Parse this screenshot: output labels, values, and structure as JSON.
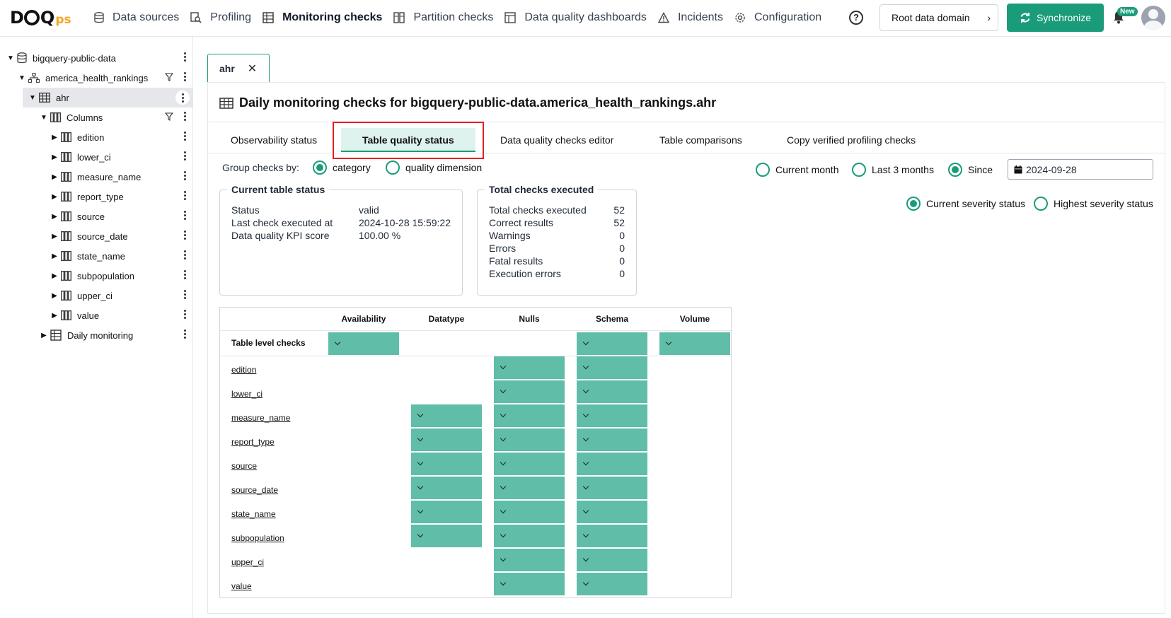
{
  "logo": {
    "main": "DQ",
    "suffix": "ps"
  },
  "nav": [
    {
      "label": "Data sources",
      "icon": "database-icon",
      "active": false
    },
    {
      "label": "Profiling",
      "icon": "profiling-icon",
      "active": false
    },
    {
      "label": "Monitoring checks",
      "icon": "table-check-icon",
      "active": true
    },
    {
      "label": "Partition checks",
      "icon": "partition-icon",
      "active": false
    },
    {
      "label": "Data quality dashboards",
      "icon": "dashboard-icon",
      "active": false
    },
    {
      "label": "Incidents",
      "icon": "warning-icon",
      "active": false
    },
    {
      "label": "Configuration",
      "icon": "gear-icon",
      "active": false
    }
  ],
  "header": {
    "help": "?",
    "domain": "Root data domain",
    "sync": "Synchronize",
    "new_badge": "New"
  },
  "tree": [
    {
      "label": "bigquery-public-data",
      "depth": 0,
      "caret": "▼",
      "icon": "database-icon",
      "filter": false
    },
    {
      "label": "america_health_rankings",
      "depth": 1,
      "caret": "▼",
      "icon": "schema-icon",
      "filter": true
    },
    {
      "label": "ahr",
      "depth": 2,
      "caret": "▼",
      "icon": "table-icon",
      "filter": false,
      "selected": true
    },
    {
      "label": "Columns",
      "depth": 3,
      "caret": "▼",
      "icon": "columns-icon",
      "filter": true
    },
    {
      "label": "edition",
      "depth": 4,
      "caret": "▶",
      "icon": "columns-icon",
      "filter": false
    },
    {
      "label": "lower_ci",
      "depth": 4,
      "caret": "▶",
      "icon": "columns-icon",
      "filter": false
    },
    {
      "label": "measure_name",
      "depth": 4,
      "caret": "▶",
      "icon": "columns-icon",
      "filter": false
    },
    {
      "label": "report_type",
      "depth": 4,
      "caret": "▶",
      "icon": "columns-icon",
      "filter": false
    },
    {
      "label": "source",
      "depth": 4,
      "caret": "▶",
      "icon": "columns-icon",
      "filter": false
    },
    {
      "label": "source_date",
      "depth": 4,
      "caret": "▶",
      "icon": "columns-icon",
      "filter": false
    },
    {
      "label": "state_name",
      "depth": 4,
      "caret": "▶",
      "icon": "columns-icon",
      "filter": false
    },
    {
      "label": "subpopulation",
      "depth": 4,
      "caret": "▶",
      "icon": "columns-icon",
      "filter": false
    },
    {
      "label": "upper_ci",
      "depth": 4,
      "caret": "▶",
      "icon": "columns-icon",
      "filter": false
    },
    {
      "label": "value",
      "depth": 4,
      "caret": "▶",
      "icon": "columns-icon",
      "filter": false
    },
    {
      "label": "Daily monitoring",
      "depth": 3,
      "caret": "▶",
      "icon": "table-check-icon",
      "filter": false
    }
  ],
  "tab": {
    "label": "ahr",
    "close": "✕"
  },
  "title": "Daily monitoring checks for bigquery-public-data.america_health_rankings.ahr",
  "subtabs": [
    "Observability status",
    "Table quality status",
    "Data quality checks editor",
    "Table comparisons",
    "Copy verified profiling checks"
  ],
  "group_by": {
    "label": "Group checks by:",
    "options": [
      "category",
      "quality dimension"
    ],
    "selected": 0
  },
  "period": {
    "options": [
      "Current month",
      "Last 3 months",
      "Since"
    ],
    "selected": 2,
    "since_date": "2024-09-28"
  },
  "severity": {
    "options": [
      "Current severity status",
      "Highest severity status"
    ],
    "selected": 0
  },
  "status_box": {
    "title": "Current table status",
    "rows": [
      {
        "k": "Status",
        "v": "valid"
      },
      {
        "k": "Last check executed at",
        "v": "2024-10-28 15:59:22"
      },
      {
        "k": "Data quality KPI score",
        "v": "100.00 %"
      }
    ]
  },
  "totals_box": {
    "title": "Total checks executed",
    "rows": [
      {
        "k": "Total checks executed",
        "v": "52"
      },
      {
        "k": "Correct results",
        "v": "52"
      },
      {
        "k": "Warnings",
        "v": "0"
      },
      {
        "k": "Errors",
        "v": "0"
      },
      {
        "k": "Fatal results",
        "v": "0"
      },
      {
        "k": "Execution errors",
        "v": "0"
      }
    ]
  },
  "grid": {
    "columns": [
      "Availability",
      "Datatype",
      "Nulls",
      "Schema",
      "Volume"
    ],
    "rows": [
      {
        "label": "Table level checks",
        "bold": true,
        "cells": [
          true,
          false,
          false,
          true,
          true
        ]
      },
      {
        "label": "edition",
        "cells": [
          false,
          false,
          true,
          true,
          false
        ]
      },
      {
        "label": "lower_ci",
        "cells": [
          false,
          false,
          true,
          true,
          false
        ]
      },
      {
        "label": "measure_name",
        "cells": [
          false,
          true,
          true,
          true,
          false
        ]
      },
      {
        "label": "report_type",
        "cells": [
          false,
          true,
          true,
          true,
          false
        ]
      },
      {
        "label": "source",
        "cells": [
          false,
          true,
          true,
          true,
          false
        ]
      },
      {
        "label": "source_date",
        "cells": [
          false,
          true,
          true,
          true,
          false
        ]
      },
      {
        "label": "state_name",
        "cells": [
          false,
          true,
          true,
          true,
          false
        ]
      },
      {
        "label": "subpopulation",
        "cells": [
          false,
          true,
          true,
          true,
          false
        ]
      },
      {
        "label": "upper_ci",
        "cells": [
          false,
          false,
          true,
          true,
          false
        ]
      },
      {
        "label": "value",
        "cells": [
          false,
          false,
          true,
          true,
          false
        ]
      }
    ],
    "status_color": "#5fbda8"
  },
  "colors": {
    "accent": "#1a9c7a",
    "highlight": "#e02020"
  }
}
